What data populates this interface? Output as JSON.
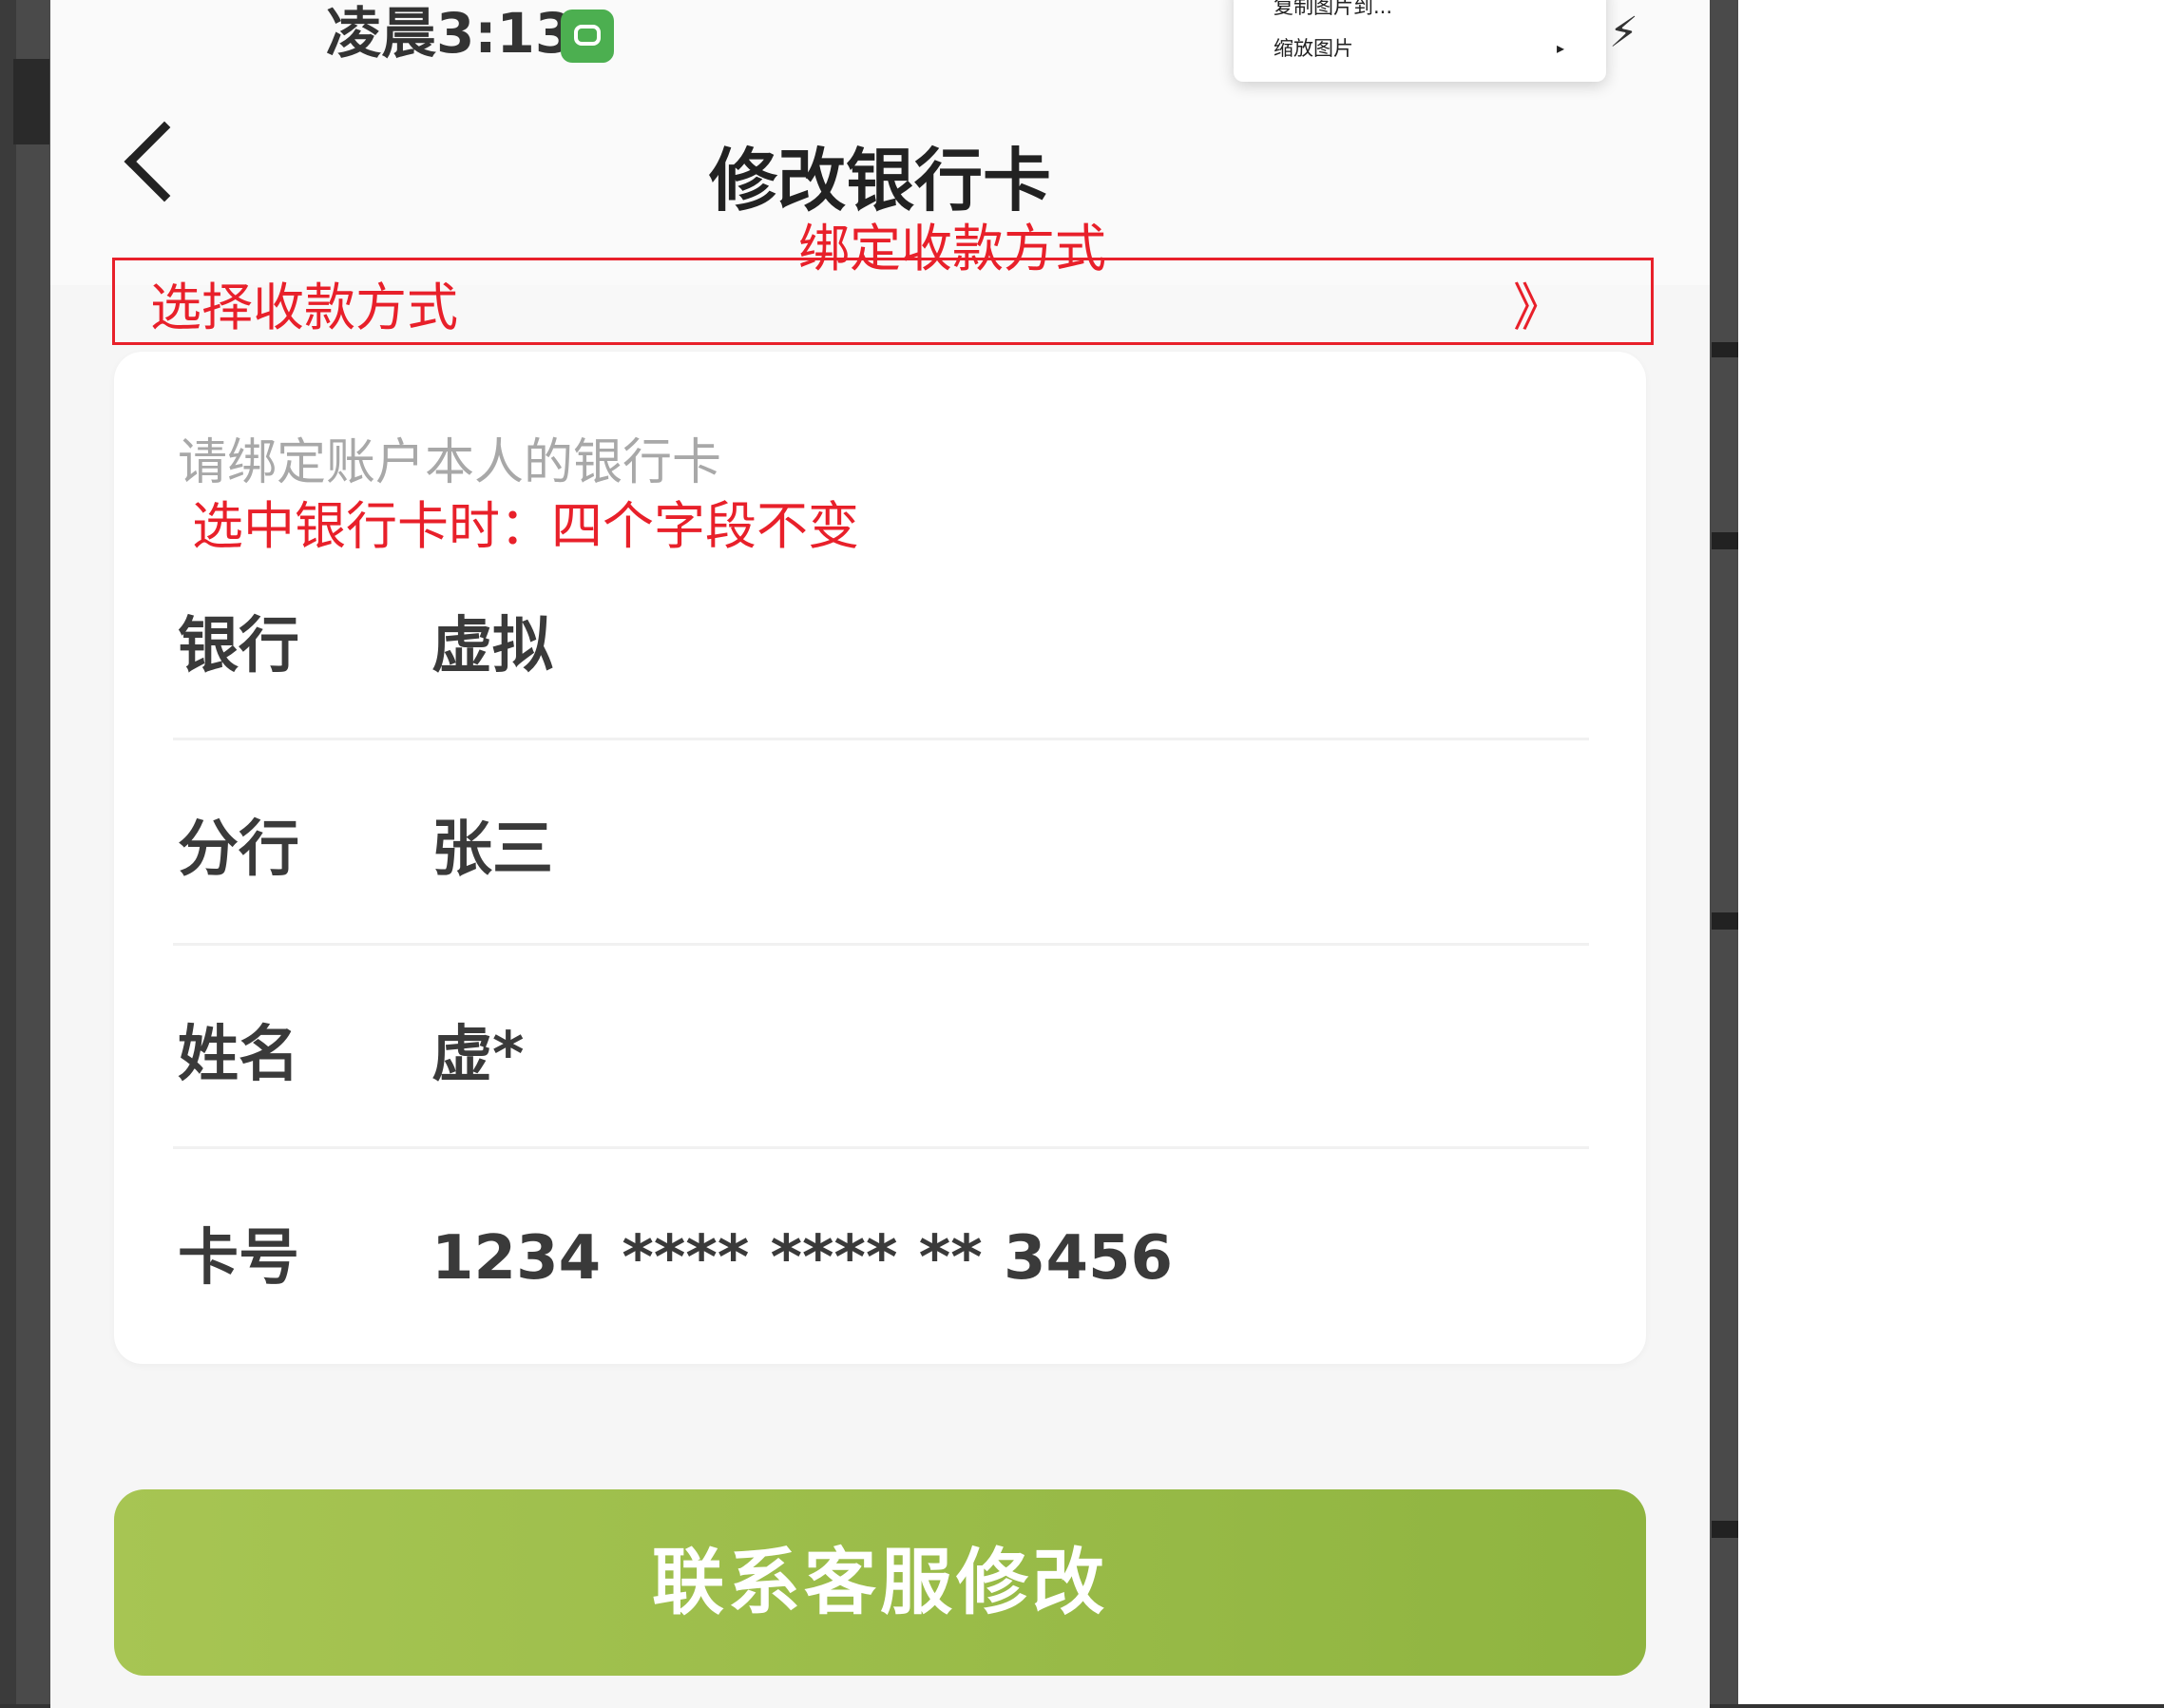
{
  "status_bar": {
    "time": "凌晨3:13",
    "bolt": "⚡"
  },
  "context_menu": {
    "items": [
      "复制图片到...",
      "缩放图片"
    ],
    "submenu_arrow": "▸"
  },
  "header": {
    "title": "修改银行卡"
  },
  "annotations": {
    "box_title": "绑定收款方式",
    "box_label": "选择收款方式",
    "box_chevron": "》",
    "note": "选中银行卡时：四个字段不变",
    "color": "#e8202a"
  },
  "card": {
    "hint": "请绑定账户本人的银行卡",
    "fields": [
      {
        "label": "银行",
        "value": "虚拟"
      },
      {
        "label": "分行",
        "value": "张三"
      },
      {
        "label": "姓名",
        "value": "虚*"
      },
      {
        "label": "卡号",
        "value": "1234 **** **** ** 3456"
      }
    ]
  },
  "footer": {
    "button_label": "联系客服修改",
    "button_color": "#9bbd4a"
  }
}
